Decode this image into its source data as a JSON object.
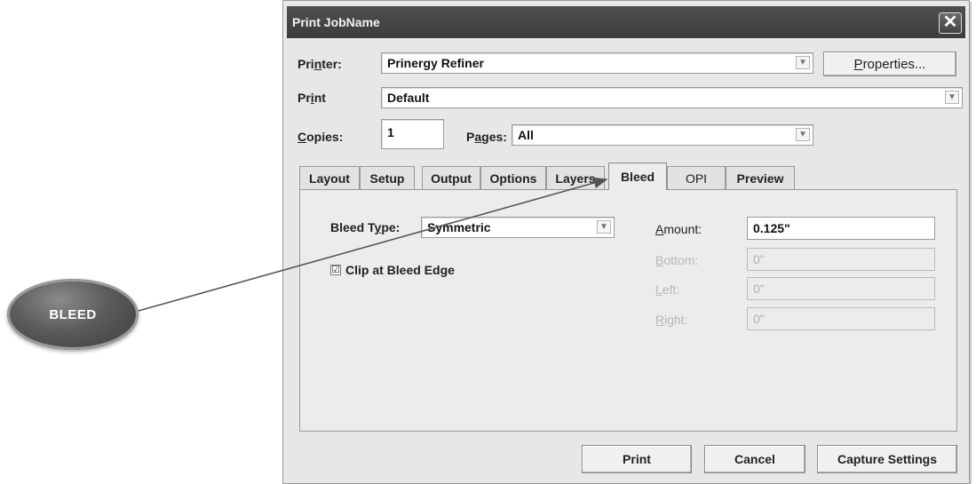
{
  "annotation": {
    "label": "BLEED"
  },
  "dialog": {
    "title": "Print JobName",
    "close_glyph": "✕",
    "printer": {
      "label_pre": "Pri",
      "label_u": "n",
      "label_post": "ter:",
      "value": "Prinergy Refiner",
      "properties_pre": "",
      "properties_u": "P",
      "properties_post": "roperties..."
    },
    "print": {
      "label_pre": "Pr",
      "label_u": "i",
      "label_post": "nt",
      "value": "Default"
    },
    "copies": {
      "label_pre": "",
      "label_u": "C",
      "label_post": "opies:",
      "value": "1"
    },
    "pages": {
      "label_pre": "P",
      "label_u": "a",
      "label_post": "ges:",
      "value": "All"
    },
    "tabs": [
      "Layout",
      "Setup",
      "Output",
      "Options",
      "Layers",
      "Bleed",
      "OPI",
      "Preview"
    ],
    "active_tab": "Bleed",
    "bleed": {
      "type_label_pre": "Bleed T",
      "type_label_u": "y",
      "type_label_post": "pe:",
      "type_value": "Symmetric",
      "clip_label": "Clip at Bleed Edge",
      "clip_checked": "☑",
      "amount": {
        "label_pre": "",
        "label_u": "A",
        "label_post": "mount:",
        "value": "0.125\""
      },
      "bottom": {
        "label_pre": "",
        "label_u": "B",
        "label_post": "ottom:",
        "value": "0\""
      },
      "left": {
        "label_pre": "",
        "label_u": "L",
        "label_post": "eft:",
        "value": "0\""
      },
      "right": {
        "label_pre": "",
        "label_u": "R",
        "label_post": "ight:",
        "value": "0\""
      }
    },
    "buttons": {
      "print": "Print",
      "cancel": "Cancel",
      "capture": "Capture Settings"
    }
  }
}
